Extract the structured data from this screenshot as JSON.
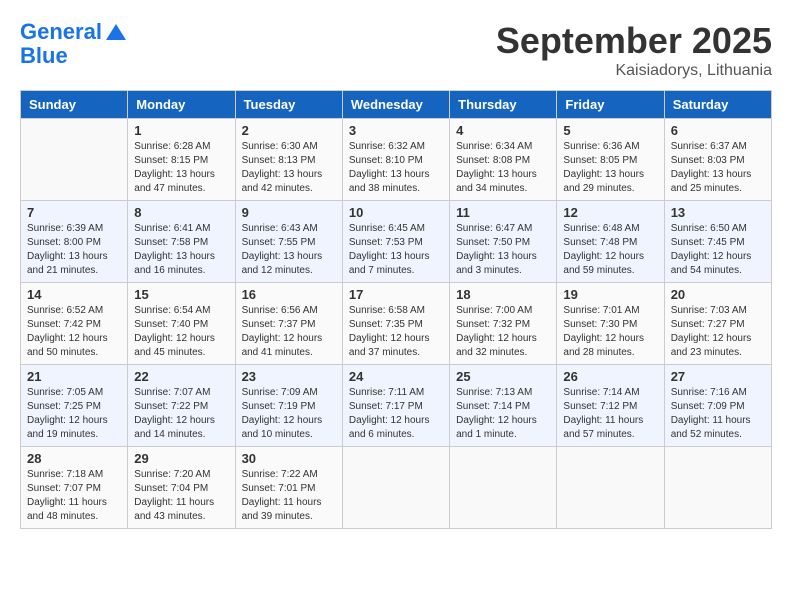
{
  "header": {
    "logo_line1": "General",
    "logo_line2": "Blue",
    "month_title": "September 2025",
    "subtitle": "Kaisiadorys, Lithuania"
  },
  "days_of_week": [
    "Sunday",
    "Monday",
    "Tuesday",
    "Wednesday",
    "Thursday",
    "Friday",
    "Saturday"
  ],
  "weeks": [
    [
      {
        "day": "",
        "info": ""
      },
      {
        "day": "1",
        "info": "Sunrise: 6:28 AM\nSunset: 8:15 PM\nDaylight: 13 hours\nand 47 minutes."
      },
      {
        "day": "2",
        "info": "Sunrise: 6:30 AM\nSunset: 8:13 PM\nDaylight: 13 hours\nand 42 minutes."
      },
      {
        "day": "3",
        "info": "Sunrise: 6:32 AM\nSunset: 8:10 PM\nDaylight: 13 hours\nand 38 minutes."
      },
      {
        "day": "4",
        "info": "Sunrise: 6:34 AM\nSunset: 8:08 PM\nDaylight: 13 hours\nand 34 minutes."
      },
      {
        "day": "5",
        "info": "Sunrise: 6:36 AM\nSunset: 8:05 PM\nDaylight: 13 hours\nand 29 minutes."
      },
      {
        "day": "6",
        "info": "Sunrise: 6:37 AM\nSunset: 8:03 PM\nDaylight: 13 hours\nand 25 minutes."
      }
    ],
    [
      {
        "day": "7",
        "info": "Sunrise: 6:39 AM\nSunset: 8:00 PM\nDaylight: 13 hours\nand 21 minutes."
      },
      {
        "day": "8",
        "info": "Sunrise: 6:41 AM\nSunset: 7:58 PM\nDaylight: 13 hours\nand 16 minutes."
      },
      {
        "day": "9",
        "info": "Sunrise: 6:43 AM\nSunset: 7:55 PM\nDaylight: 13 hours\nand 12 minutes."
      },
      {
        "day": "10",
        "info": "Sunrise: 6:45 AM\nSunset: 7:53 PM\nDaylight: 13 hours\nand 7 minutes."
      },
      {
        "day": "11",
        "info": "Sunrise: 6:47 AM\nSunset: 7:50 PM\nDaylight: 13 hours\nand 3 minutes."
      },
      {
        "day": "12",
        "info": "Sunrise: 6:48 AM\nSunset: 7:48 PM\nDaylight: 12 hours\nand 59 minutes."
      },
      {
        "day": "13",
        "info": "Sunrise: 6:50 AM\nSunset: 7:45 PM\nDaylight: 12 hours\nand 54 minutes."
      }
    ],
    [
      {
        "day": "14",
        "info": "Sunrise: 6:52 AM\nSunset: 7:42 PM\nDaylight: 12 hours\nand 50 minutes."
      },
      {
        "day": "15",
        "info": "Sunrise: 6:54 AM\nSunset: 7:40 PM\nDaylight: 12 hours\nand 45 minutes."
      },
      {
        "day": "16",
        "info": "Sunrise: 6:56 AM\nSunset: 7:37 PM\nDaylight: 12 hours\nand 41 minutes."
      },
      {
        "day": "17",
        "info": "Sunrise: 6:58 AM\nSunset: 7:35 PM\nDaylight: 12 hours\nand 37 minutes."
      },
      {
        "day": "18",
        "info": "Sunrise: 7:00 AM\nSunset: 7:32 PM\nDaylight: 12 hours\nand 32 minutes."
      },
      {
        "day": "19",
        "info": "Sunrise: 7:01 AM\nSunset: 7:30 PM\nDaylight: 12 hours\nand 28 minutes."
      },
      {
        "day": "20",
        "info": "Sunrise: 7:03 AM\nSunset: 7:27 PM\nDaylight: 12 hours\nand 23 minutes."
      }
    ],
    [
      {
        "day": "21",
        "info": "Sunrise: 7:05 AM\nSunset: 7:25 PM\nDaylight: 12 hours\nand 19 minutes."
      },
      {
        "day": "22",
        "info": "Sunrise: 7:07 AM\nSunset: 7:22 PM\nDaylight: 12 hours\nand 14 minutes."
      },
      {
        "day": "23",
        "info": "Sunrise: 7:09 AM\nSunset: 7:19 PM\nDaylight: 12 hours\nand 10 minutes."
      },
      {
        "day": "24",
        "info": "Sunrise: 7:11 AM\nSunset: 7:17 PM\nDaylight: 12 hours\nand 6 minutes."
      },
      {
        "day": "25",
        "info": "Sunrise: 7:13 AM\nSunset: 7:14 PM\nDaylight: 12 hours\nand 1 minute."
      },
      {
        "day": "26",
        "info": "Sunrise: 7:14 AM\nSunset: 7:12 PM\nDaylight: 11 hours\nand 57 minutes."
      },
      {
        "day": "27",
        "info": "Sunrise: 7:16 AM\nSunset: 7:09 PM\nDaylight: 11 hours\nand 52 minutes."
      }
    ],
    [
      {
        "day": "28",
        "info": "Sunrise: 7:18 AM\nSunset: 7:07 PM\nDaylight: 11 hours\nand 48 minutes."
      },
      {
        "day": "29",
        "info": "Sunrise: 7:20 AM\nSunset: 7:04 PM\nDaylight: 11 hours\nand 43 minutes."
      },
      {
        "day": "30",
        "info": "Sunrise: 7:22 AM\nSunset: 7:01 PM\nDaylight: 11 hours\nand 39 minutes."
      },
      {
        "day": "",
        "info": ""
      },
      {
        "day": "",
        "info": ""
      },
      {
        "day": "",
        "info": ""
      },
      {
        "day": "",
        "info": ""
      }
    ]
  ]
}
